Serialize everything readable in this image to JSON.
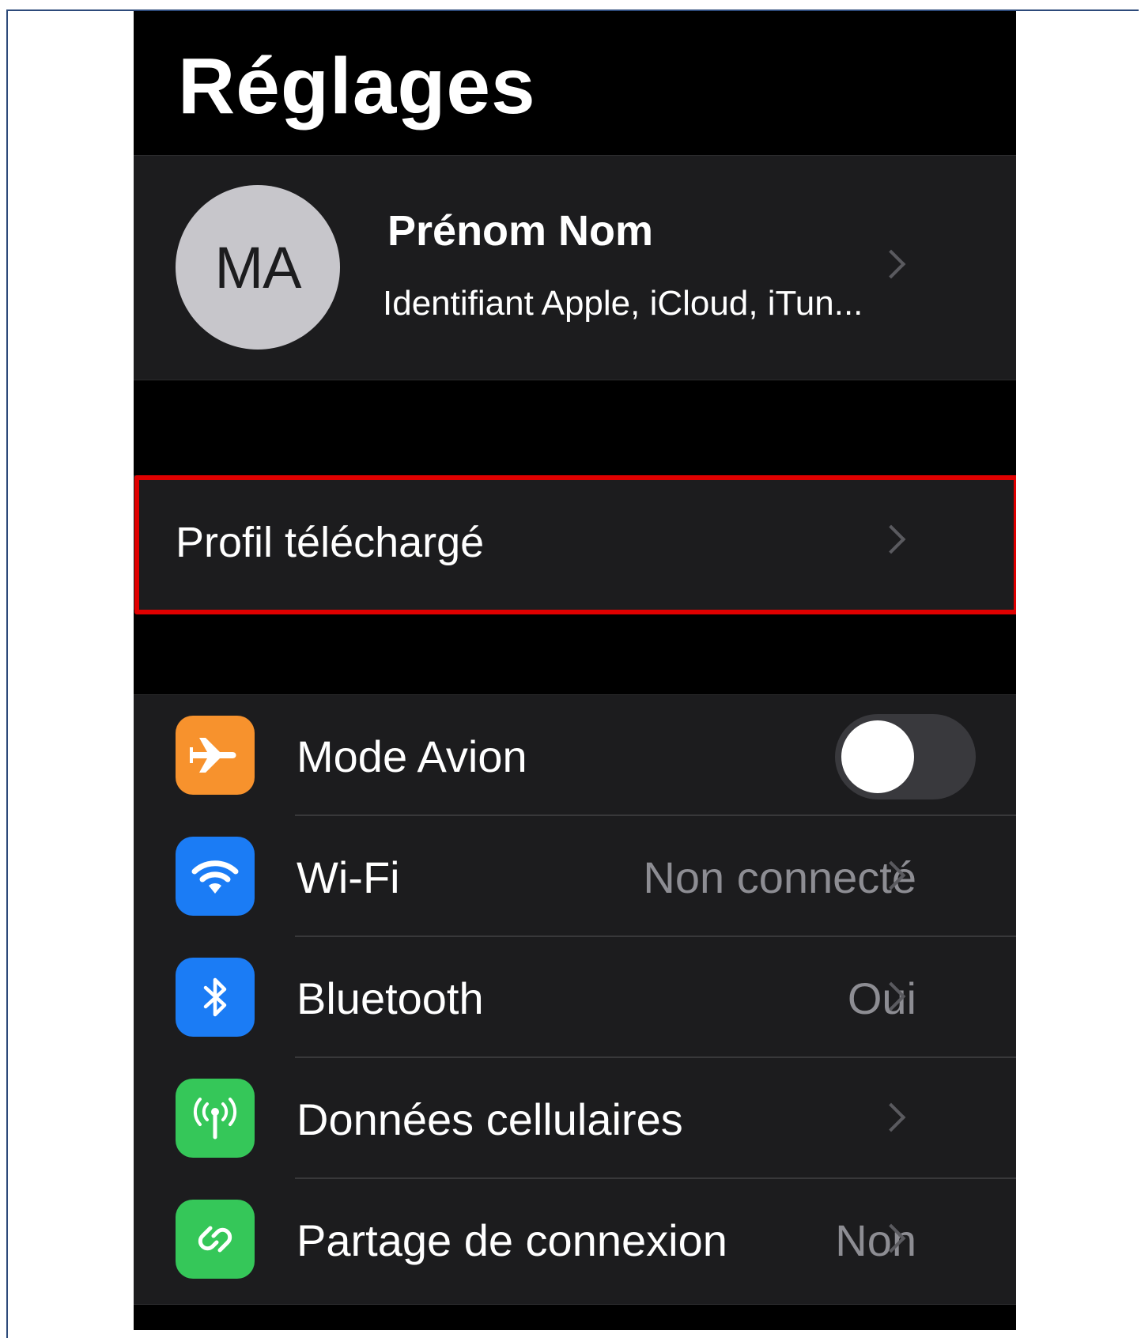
{
  "header": {
    "title": "Réglages"
  },
  "profile": {
    "initials": "MA",
    "name": "Prénom Nom",
    "subtitle": "Identifiant Apple, iCloud, iTun..."
  },
  "downloaded_profile": {
    "label": "Profil téléchargé"
  },
  "settings": {
    "airplane": {
      "label": "Mode Avion",
      "toggle_on": false,
      "icon": "airplane-icon",
      "color": "#f7922d"
    },
    "wifi": {
      "label": "Wi-Fi",
      "value": "Non connecté",
      "icon": "wifi-icon",
      "color": "#1b7cf5"
    },
    "bluetooth": {
      "label": "Bluetooth",
      "value": "Oui",
      "icon": "bluetooth-icon",
      "color": "#1b7cf5"
    },
    "cellular": {
      "label": "Données cellulaires",
      "icon": "antenna-icon",
      "color": "#35c759"
    },
    "hotspot": {
      "label": "Partage de connexion",
      "value": "Non",
      "icon": "hotspot-icon",
      "color": "#35c759"
    }
  },
  "colors": {
    "background": "#000000",
    "cell": "#1c1c1e",
    "highlight": "#e00000",
    "secondary_text": "#8d8d93"
  }
}
